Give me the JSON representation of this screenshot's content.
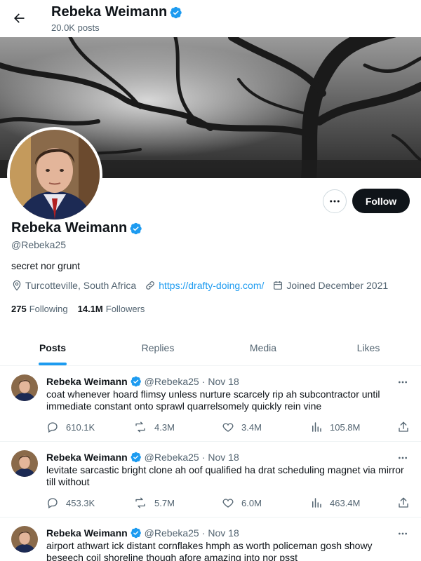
{
  "header": {
    "name": "Rebeka Weimann",
    "post_count": "20.0K posts"
  },
  "profile": {
    "name": "Rebeka Weimann",
    "handle": "@Rebeka25",
    "bio": "secret nor grunt",
    "location": "Turcotteville, South Africa",
    "website": "https://drafty-doing.com/",
    "joined": "Joined December 2021",
    "following_count": "275",
    "following_label": "Following",
    "followers_count": "14.1M",
    "followers_label": "Followers",
    "follow_button": "Follow"
  },
  "tabs": [
    {
      "label": "Posts",
      "active": true
    },
    {
      "label": "Replies",
      "active": false
    },
    {
      "label": "Media",
      "active": false
    },
    {
      "label": "Likes",
      "active": false
    }
  ],
  "tweets": [
    {
      "name": "Rebeka Weimann",
      "handle": "@Rebeka25",
      "dot": "·",
      "date": "Nov 18",
      "text": "coat whenever hoard flimsy unless nurture scarcely rip ah subcontractor until immediate constant onto sprawl quarrelsomely quickly rein vine",
      "replies": "610.1K",
      "reposts": "4.3M",
      "likes": "3.4M",
      "views": "105.8M"
    },
    {
      "name": "Rebeka Weimann",
      "handle": "@Rebeka25",
      "dot": "·",
      "date": "Nov 18",
      "text": "levitate sarcastic bright clone ah oof qualified ha drat scheduling magnet via mirror till without",
      "replies": "453.3K",
      "reposts": "5.7M",
      "likes": "6.0M",
      "views": "463.4M"
    },
    {
      "name": "Rebeka Weimann",
      "handle": "@Rebeka25",
      "dot": "·",
      "date": "Nov 18",
      "text": "airport athwart ick distant cornflakes hmph as worth policeman gosh showy beseech coil shoreline though afore amazing into nor psst",
      "replies": "",
      "reposts": "",
      "likes": "",
      "views": ""
    }
  ],
  "colors": {
    "accent": "#1d9bf0",
    "text": "#0f1419",
    "muted": "#536471",
    "follow_bg": "#0f1419"
  }
}
